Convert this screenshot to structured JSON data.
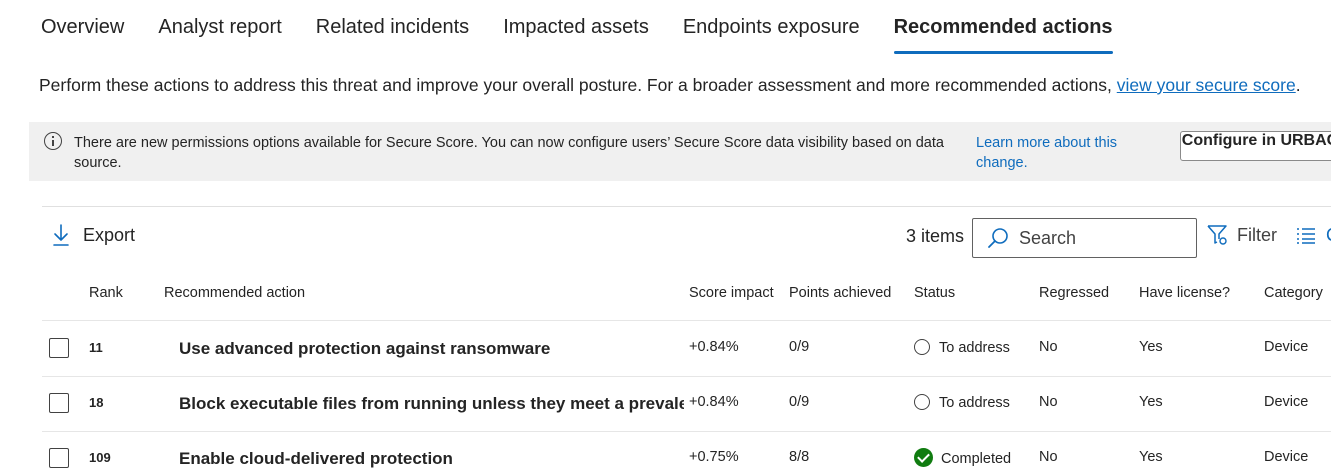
{
  "tabs": [
    {
      "label": "Overview"
    },
    {
      "label": "Analyst report"
    },
    {
      "label": "Related incidents"
    },
    {
      "label": "Impacted assets"
    },
    {
      "label": "Endpoints exposure"
    },
    {
      "label": "Recommended actions",
      "active": true
    }
  ],
  "description": {
    "text": "Perform these actions to address this threat and improve your overall posture. For a broader assessment and more recommended actions, ",
    "link": "view your secure score",
    "suffix": "."
  },
  "banner": {
    "text": "There are new permissions options available for Secure Score. You can now configure users’ Secure Score data visibility based on data source.",
    "link": "Learn more about this change.",
    "button": "Configure in URBAC"
  },
  "toolbar": {
    "export_label": "Export",
    "items_count": "3 items",
    "search_placeholder": "Search",
    "filter_label": "Filter",
    "columns_label": "C"
  },
  "table": {
    "headers": {
      "rank": "Rank",
      "action": "Recommended action",
      "score_impact": "Score impact",
      "points": "Points achieved",
      "status": "Status",
      "regressed": "Regressed",
      "license": "Have license?",
      "category": "Category"
    },
    "rows": [
      {
        "rank": "11",
        "action": "Use advanced protection against ransomware",
        "score_impact": "+0.84%",
        "points": "0/9",
        "status": "To address",
        "regressed": "No",
        "license": "Yes",
        "category": "Device"
      },
      {
        "rank": "18",
        "action": "Block executable files from running unless they meet a prevalence, age, or trusted list criterion",
        "score_impact": "+0.84%",
        "points": "0/9",
        "status": "To address",
        "regressed": "No",
        "license": "Yes",
        "category": "Device"
      },
      {
        "rank": "109",
        "action": "Enable cloud-delivered protection",
        "score_impact": "+0.75%",
        "points": "8/8",
        "status": "Completed",
        "regressed": "No",
        "license": "Yes",
        "category": "Device"
      }
    ]
  },
  "colors": {
    "accent": "#0f6cbd",
    "completed": "#107c10",
    "banner_bg": "#f0f0f0"
  }
}
